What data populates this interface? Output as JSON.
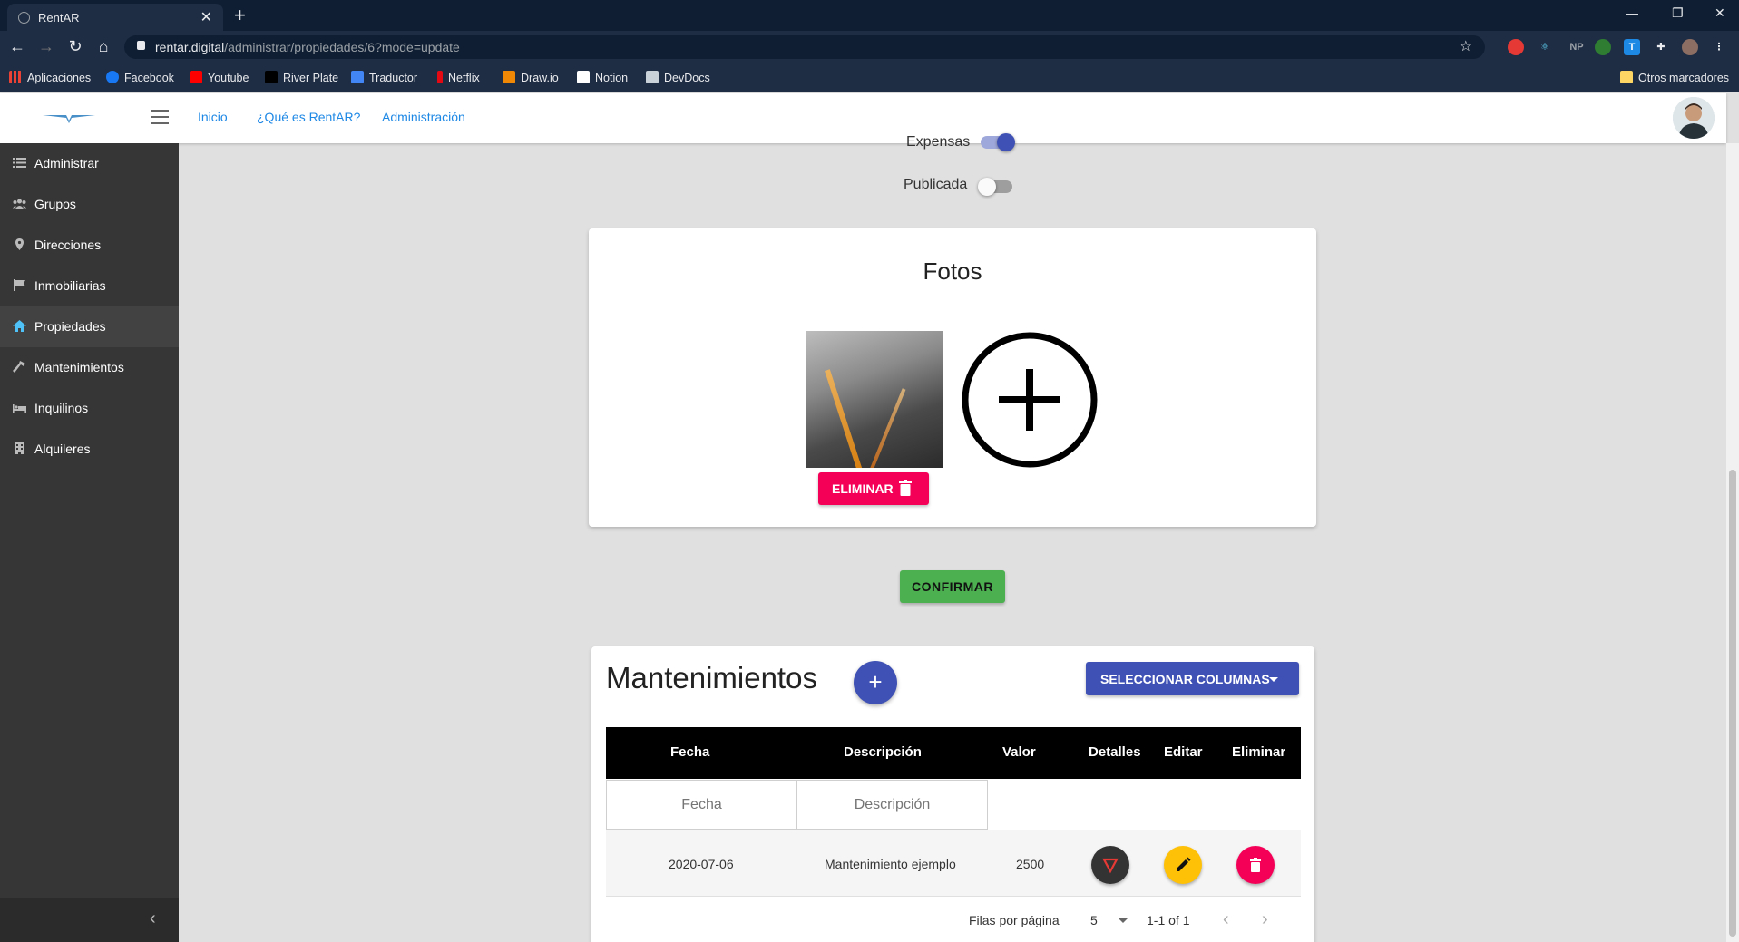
{
  "browser": {
    "tab_title": "RentAR",
    "url_host": "rentar.digital",
    "url_path": "/administrar/propiedades/6?mode=update",
    "bookmarks": [
      "Aplicaciones",
      "Facebook",
      "Youtube",
      "River Plate",
      "Traductor",
      "Netflix",
      "Draw.io",
      "Notion",
      "DevDocs"
    ],
    "other_bookmarks": "Otros marcadores",
    "ext_np": "NP"
  },
  "header": {
    "nav": [
      "Inicio",
      "¿Qué es RentAR?",
      "Administración"
    ]
  },
  "sidebar": {
    "items": [
      {
        "label": "Administrar",
        "icon": "list-icon"
      },
      {
        "label": "Grupos",
        "icon": "group-icon"
      },
      {
        "label": "Direcciones",
        "icon": "location-pin-icon"
      },
      {
        "label": "Inmobiliarias",
        "icon": "flag-icon"
      },
      {
        "label": "Propiedades",
        "icon": "home-icon"
      },
      {
        "label": "Mantenimientos",
        "icon": "hammer-icon"
      },
      {
        "label": "Inquilinos",
        "icon": "bed-icon"
      },
      {
        "label": "Alquileres",
        "icon": "building-icon"
      }
    ],
    "active_index": 4
  },
  "form": {
    "expensas_label": "Expensas",
    "expensas_on": true,
    "publicada_label": "Publicada",
    "publicada_on": false
  },
  "fotos": {
    "title": "Fotos",
    "delete_label": "ELIMINAR"
  },
  "confirm_label": "CONFIRMAR",
  "mantenimientos": {
    "title": "Mantenimientos",
    "select_columns_label": "SELECCIONAR COLUMNAS",
    "columns": [
      "Fecha",
      "Descripción",
      "Valor",
      "Detalles",
      "Editar",
      "Eliminar"
    ],
    "filter_placeholders": {
      "fecha": "Fecha",
      "descripcion": "Descripción"
    },
    "rows": [
      {
        "fecha": "2020-07-06",
        "descripcion": "Mantenimiento ejemplo",
        "valor": "2500"
      }
    ],
    "pagination": {
      "rows_per_page_label": "Filas por página",
      "rows_per_page": "5",
      "range": "1-1 of 1"
    }
  },
  "colors": {
    "primary": "#3f51b5",
    "danger": "#f50057",
    "success": "#4caf50",
    "warning": "#ffc107",
    "link": "#1e88e5",
    "sidebar": "#363636"
  }
}
